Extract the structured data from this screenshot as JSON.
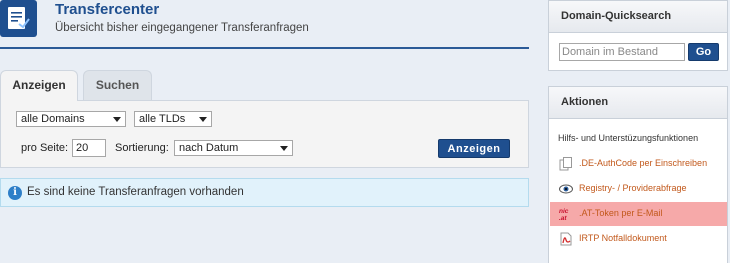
{
  "header": {
    "title": "Transfercenter",
    "subtitle": "Übersicht bisher eingegangener Transferanfragen",
    "icon": "document-transfer-icon"
  },
  "tabs": [
    {
      "label": "Anzeigen",
      "active": true
    },
    {
      "label": "Suchen",
      "active": false
    }
  ],
  "filter": {
    "domains_selected": "alle Domains",
    "tlds_selected": "alle TLDs",
    "per_page_label": "pro Seite:",
    "per_page_value": "20",
    "sort_label": "Sortierung:",
    "sort_selected": "nach Datum",
    "submit_label": "Anzeigen"
  },
  "info": {
    "icon": "info-icon",
    "message": "Es sind keine Transferanfragen vorhanden"
  },
  "quicksearch": {
    "title": "Domain-Quicksearch",
    "placeholder": "Domain im Bestand",
    "button_label": "Go"
  },
  "actions": {
    "title": "Aktionen",
    "subtitle": "Hilfs- und Unterstüzungsfunktionen",
    "items": [
      {
        "label": ".DE-AuthCode per Einschreiben",
        "icon": "documents-icon",
        "highlighted": false
      },
      {
        "label": "Registry- / Providerabfrage",
        "icon": "eye-icon",
        "highlighted": false
      },
      {
        "label": ".AT-Token per E-Mail",
        "icon": "nic-at-logo-icon",
        "highlighted": true
      },
      {
        "label": "IRTP Notfalldokument",
        "icon": "pdf-icon",
        "highlighted": false
      }
    ]
  },
  "colors": {
    "brand_blue": "#1f4f8f",
    "link_orange": "#c2591c",
    "highlight_red": "#f6a9a9",
    "info_bg": "#e1f2fb"
  }
}
